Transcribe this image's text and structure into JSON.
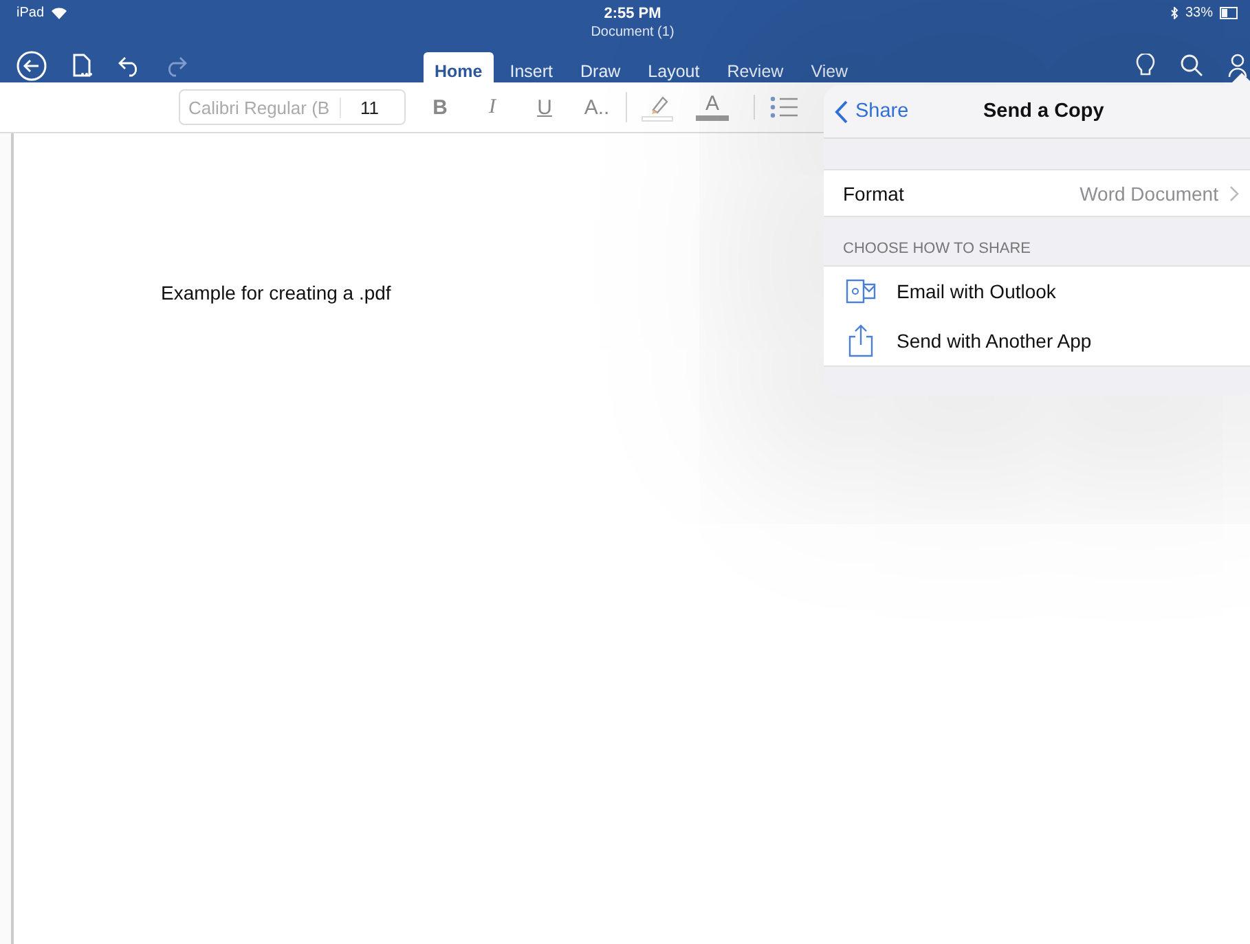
{
  "status_bar": {
    "device": "iPad",
    "time": "2:55 PM",
    "battery": "33%"
  },
  "window": {
    "title": "Document (1)"
  },
  "tabs": [
    {
      "label": "Home",
      "selected": true
    },
    {
      "label": "Insert",
      "selected": false
    },
    {
      "label": "Draw",
      "selected": false
    },
    {
      "label": "Layout",
      "selected": false
    },
    {
      "label": "Review",
      "selected": false
    },
    {
      "label": "View",
      "selected": false
    }
  ],
  "ribbon": {
    "font_name": "Calibri Regular (B",
    "font_size": "11",
    "buttons": [
      {
        "kind": "bold",
        "label": "B"
      },
      {
        "kind": "italic",
        "label": "I"
      },
      {
        "kind": "underline",
        "label": "U"
      },
      {
        "kind": "styles",
        "label": "A.."
      },
      {
        "kind": "highlight"
      },
      {
        "kind": "font-color",
        "label": "A"
      },
      {
        "kind": "bullets"
      }
    ]
  },
  "document": {
    "text": "Example for creating a .pdf"
  },
  "share_panel": {
    "back_label": "Share",
    "title": "Send a Copy",
    "format_label": "Format",
    "format_value": "Word Document",
    "section_header": "CHOOSE HOW TO SHARE",
    "options": [
      {
        "kind": "outlook",
        "label": "Email with Outlook"
      },
      {
        "kind": "share",
        "label": "Send with Another App"
      }
    ]
  }
}
